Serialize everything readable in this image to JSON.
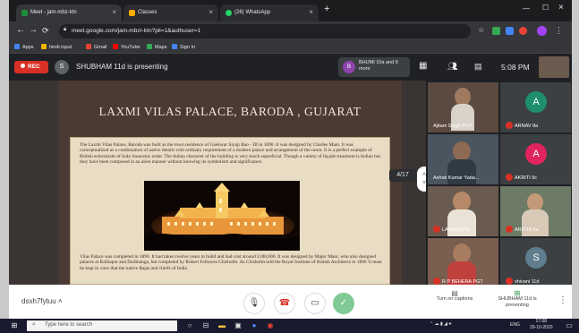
{
  "browser": {
    "tabs": [
      {
        "label": "Meet - jam-mbz-ktn",
        "active": true,
        "color": "#1e8e3e"
      },
      {
        "label": "Classes",
        "active": false,
        "color": "#f9ab00"
      },
      {
        "label": "(26) WhatsApp",
        "active": false,
        "color": "#25d366"
      }
    ],
    "url": "meet.google.com/jam-mbzr-ktn?pli=1&authuser=1",
    "bookmarks": [
      {
        "label": "Apps",
        "color": "#4285f4"
      },
      {
        "label": "hindi input",
        "color": "#f4b400"
      },
      {
        "label": "Gmail",
        "color": "#ea4335"
      },
      {
        "label": "YouTube",
        "color": "#ff0000"
      },
      {
        "label": "Maps",
        "color": "#34a853"
      },
      {
        "label": "Sign In",
        "color": "#4285f4"
      }
    ]
  },
  "meet": {
    "rec_label": "REC",
    "presenter_initial": "S",
    "presenting_text": "SHUBHAM 11d is presenting",
    "chip_initial": "B",
    "chip_text": "BHUMI 10a and 9 more",
    "clock": "5:08 PM",
    "meeting_code": "dsxh7fytuu",
    "page_indicator": "4/17",
    "captions_label": "Turn on captions",
    "presenting_label": "SHUBHAM 11d is presenting"
  },
  "slide": {
    "title": "LAXMI VILAS PALACE, BARODA , GUJARAT",
    "paragraph1": "The Laxmi Vilas Palace, Baroda was built as the town residence of Gaekwar Siyaji Rao - III in 1890. It was designed by Charles Mant. It was conceptualized as a combination of native details with ordinary requirement of a modern palace and arrangement of the room. It is a perfect example of British eclectisism of Indo Saracenic order. The Indian character of the building is very much superficial. Though a variety of façade treatment is Indian but they have been composed in an alien manner without knowing its symbolism and significance.",
    "paragraph2": "Vilas Palace was completed in 1890. It had taken twelve years to build and had cost around £180,000. It was designed by Major Mant, who also designed palaces at Kolhapur and Darbhanga, but completed by Robert Fellowes Chisholm. As Chisholm told the Royal Institute of British Architects in 1896 'it must be kept in view that the native Rajas and chiefs of India"
  },
  "participants": [
    {
      "name": "Ajitam Singh PGT",
      "initial": "",
      "color": "#5a4a40",
      "muted": false
    },
    {
      "name": "ARNAV 8a",
      "initial": "A",
      "color": "#1e8e6e",
      "muted": true
    },
    {
      "name": "Ashok Kumar Yada...",
      "initial": "",
      "color": "#4a5560",
      "muted": false
    },
    {
      "name": "AKRITI 9c",
      "initial": "A",
      "color": "#e0245e",
      "muted": true
    },
    {
      "name": "LAVANYA 9c",
      "initial": "",
      "color": "#6a5b50",
      "muted": true
    },
    {
      "name": "ARPITA 8a",
      "initial": "",
      "color": "#6d7a66",
      "muted": true
    },
    {
      "name": "R P BEHERA PGT",
      "initial": "",
      "color": "#7a5e50",
      "muted": true
    },
    {
      "name": "shivani 11d",
      "initial": "S",
      "color": "#5f7d8c",
      "muted": true
    }
  ],
  "taskbar": {
    "search_placeholder": "Type here to search",
    "lang": "ENG",
    "time": "17:08",
    "date": "29-10-2020"
  },
  "icons": [
    "back-icon",
    "forward-icon",
    "reload-icon",
    "home-icon",
    "mic-icon",
    "end-call-icon",
    "camera-icon",
    "check-icon",
    "captions-icon",
    "present-icon",
    "more-icon",
    "search-icon",
    "windows-icon"
  ]
}
